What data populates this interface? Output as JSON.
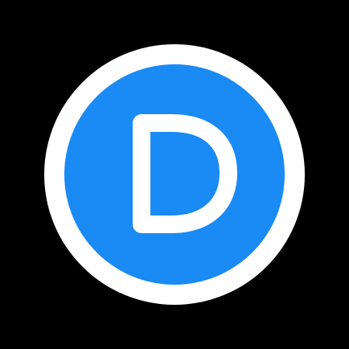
{
  "icon": {
    "name": "letter-d-logo",
    "letter": "D",
    "ring_color": "#ffffff",
    "fill_color": "#1a8af5",
    "letter_color": "#ffffff",
    "background_color": "#000000"
  }
}
